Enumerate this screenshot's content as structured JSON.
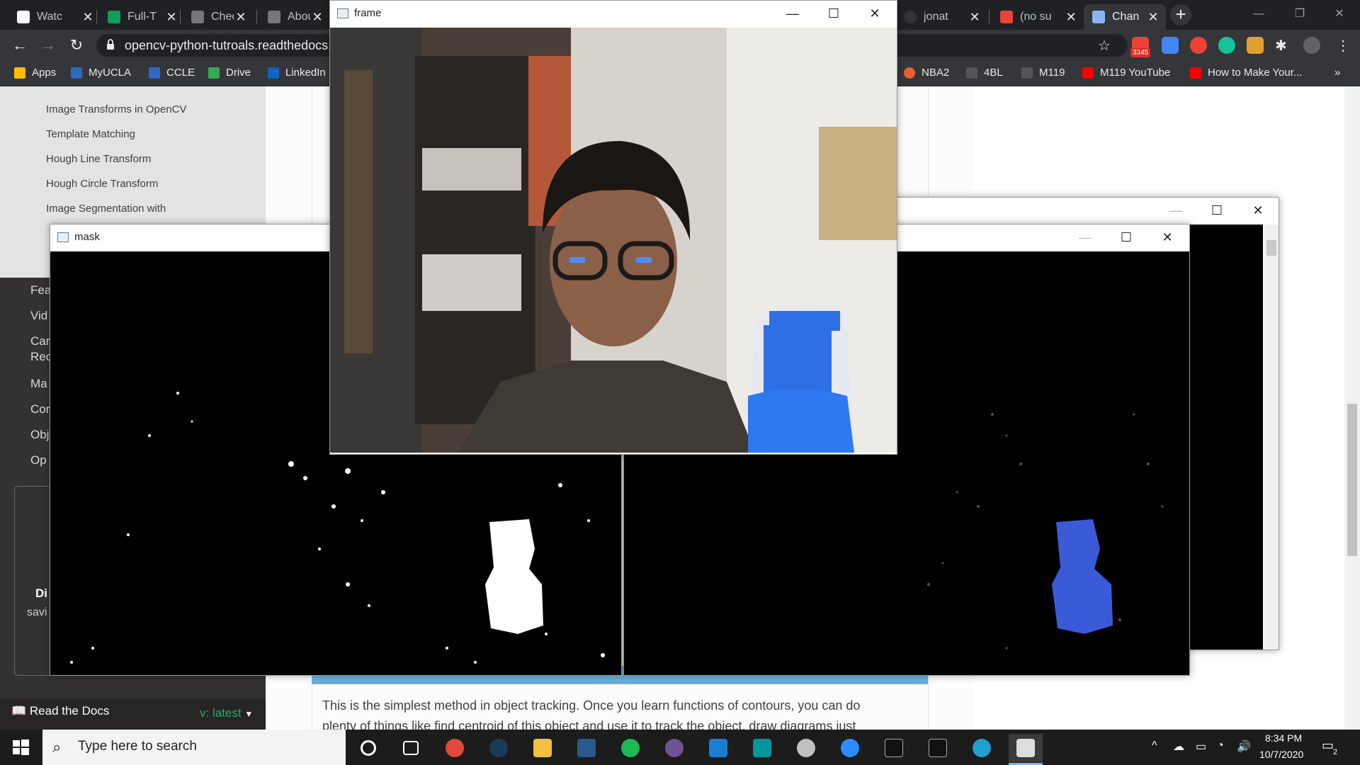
{
  "browser": {
    "tabs": [
      {
        "title": "Watc"
      },
      {
        "title": "Full-T"
      },
      {
        "title": "Chec"
      },
      {
        "title": "Abou"
      },
      {
        "title": "jonat"
      },
      {
        "title": "(no su"
      },
      {
        "title": "Chan"
      }
    ],
    "new_tab": "+",
    "url": "opencv-python-tutroals.readthedocs.",
    "badge": "3345",
    "bookmarks": [
      {
        "label": "Apps"
      },
      {
        "label": "MyUCLA"
      },
      {
        "label": "CCLE"
      },
      {
        "label": "Drive"
      },
      {
        "label": "LinkedIn"
      },
      {
        "label": "NBA2"
      },
      {
        "label": "4BL"
      },
      {
        "label": "M119"
      },
      {
        "label": "M119 YouTube"
      },
      {
        "label": "How to Make Your..."
      }
    ],
    "more": "»"
  },
  "sidebar": {
    "links": [
      {
        "label": "Image Transforms in OpenCV"
      },
      {
        "label": "Template Matching"
      },
      {
        "label": "Hough Line Transform"
      },
      {
        "label": "Hough Circle Transform"
      },
      {
        "label": "Image Segmentation with"
      }
    ],
    "cats": [
      {
        "label": "Fea"
      },
      {
        "label": "Vid"
      },
      {
        "label": "Car"
      },
      {
        "label": "Rec"
      },
      {
        "label": "Ma"
      },
      {
        "label": "Cor"
      },
      {
        "label": "Obj"
      },
      {
        "label": "Op"
      }
    ],
    "ad_title": "Di",
    "ad_sub": "savi",
    "footer_label": "Read the Docs",
    "version": "v: latest"
  },
  "content": {
    "para1": "This is the simplest method in object tracking. Once you learn functions of contours, you can do",
    "para2": "plenty of things like find centroid of this object and use it to track the object, draw diagrams just"
  },
  "windows": {
    "frame_title": "frame",
    "mask_title": "mask",
    "min": "—",
    "max": "☐",
    "close": "✕"
  },
  "taskbar": {
    "search_placeholder": "Type here to search",
    "time": "8:34 PM",
    "date": "10/7/2020",
    "notif_count": "2"
  },
  "colors": {
    "brand_rtd": "#27ae60",
    "chrome_dark": "#202124",
    "taskbar": "#1c1c1c"
  }
}
